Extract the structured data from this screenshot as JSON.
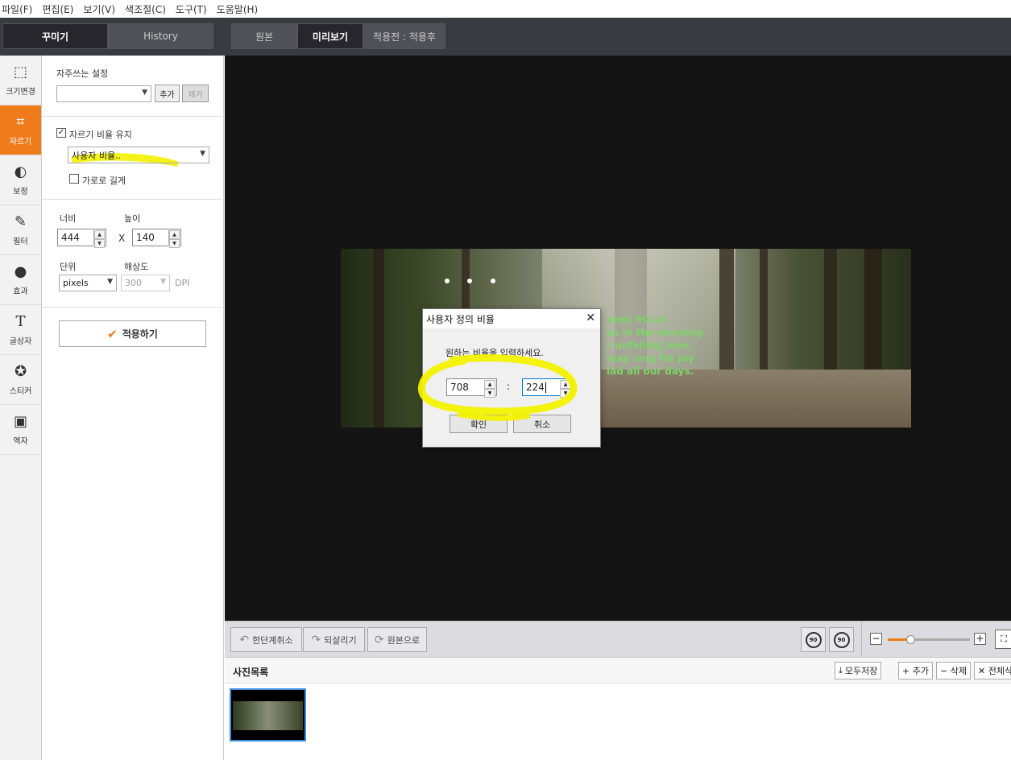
{
  "menu": [
    "파일(F)",
    "편집(E)",
    "보기(V)",
    "색조절(C)",
    "도구(T)",
    "도움말(H)"
  ],
  "left_tabs": {
    "decor": "꾸미기",
    "history": "History"
  },
  "view_tabs": {
    "original": "원본",
    "preview": "미리보기",
    "compare": "적용전 : 적용후"
  },
  "tools": [
    {
      "label": "크기변경",
      "icon": "resize-icon",
      "glyph": "⬚"
    },
    {
      "label": "자르기",
      "icon": "crop-icon",
      "glyph": "⌗"
    },
    {
      "label": "보정",
      "icon": "adjust-icon",
      "glyph": "◐"
    },
    {
      "label": "필터",
      "icon": "filter-wand-icon",
      "glyph": "✎"
    },
    {
      "label": "효과",
      "icon": "drop-icon",
      "glyph": "●"
    },
    {
      "label": "글상자",
      "icon": "text-icon",
      "glyph": "T"
    },
    {
      "label": "스티커",
      "icon": "sticker-star-icon",
      "glyph": "✪"
    },
    {
      "label": "액자",
      "icon": "frame-picture-icon",
      "glyph": "▣"
    }
  ],
  "panel": {
    "presets_label": "자주쓰는 설정",
    "preset_value": "",
    "add_label": "추가",
    "remove_label": "제거",
    "keep_ratio_label": "자르기 비율 유지",
    "keep_ratio_checked": true,
    "ratio_value": "사용자 비율..",
    "landscape_label": "가로로 길게",
    "landscape_checked": false,
    "width_label": "너비",
    "height_label": "높이",
    "width_value": "444",
    "height_value": "140",
    "x_label": "X",
    "unit_label": "단위",
    "unit_value": "pixels",
    "resolution_label": "해상도",
    "resolution_value": "300",
    "dpi_label": "DPI",
    "apply_label": "적용하기"
  },
  "canvas_verse": [
    "alms 90:14",
    "us in the morning",
    "r unfailing love,",
    "may sing for joy",
    "lad all our days."
  ],
  "dialog": {
    "title": "사용자 정의 비율",
    "message": "원하는 비율을 입력하세요.",
    "ratio_w": "708",
    "colon": ":",
    "ratio_h": "224",
    "ok_label": "확인",
    "cancel_label": "취소",
    "close_glyph": "✕"
  },
  "bottom": {
    "undo_label": "한단계취소",
    "redo_label": "되살리기",
    "reset_label": "원본으로",
    "rotate_left_label": "90",
    "rotate_right_label": "90",
    "zoom_level": 0.27
  },
  "photolist": {
    "title": "사진목록",
    "save_all_label": "모두저장",
    "add_label": "+ 추가",
    "delete_label": "− 삭제",
    "delete_all_label": "✕ 전체삭제"
  },
  "colors": {
    "accent": "#f07b1a",
    "highlight": "#f2f200"
  }
}
